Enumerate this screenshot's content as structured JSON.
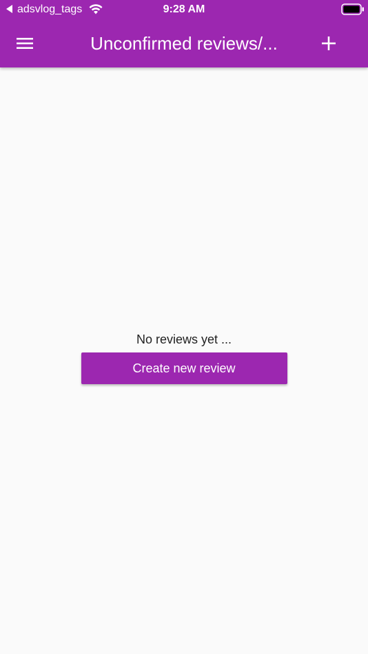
{
  "status_bar": {
    "back_app": "adsvlog_tags",
    "time": "9:28 AM",
    "icons": [
      "back-arrow-icon",
      "wifi-icon",
      "battery-icon"
    ]
  },
  "app_bar": {
    "title": "Unconfirmed reviews/...",
    "menu_icon": "hamburger-menu-icon",
    "add_icon": "plus-icon"
  },
  "empty_state": {
    "message": "No reviews yet ...",
    "button_label": "Create new review"
  },
  "colors": {
    "primary": "#9c27b0",
    "background": "#fafafa",
    "text": "#212121",
    "on_primary": "#ffffff"
  }
}
